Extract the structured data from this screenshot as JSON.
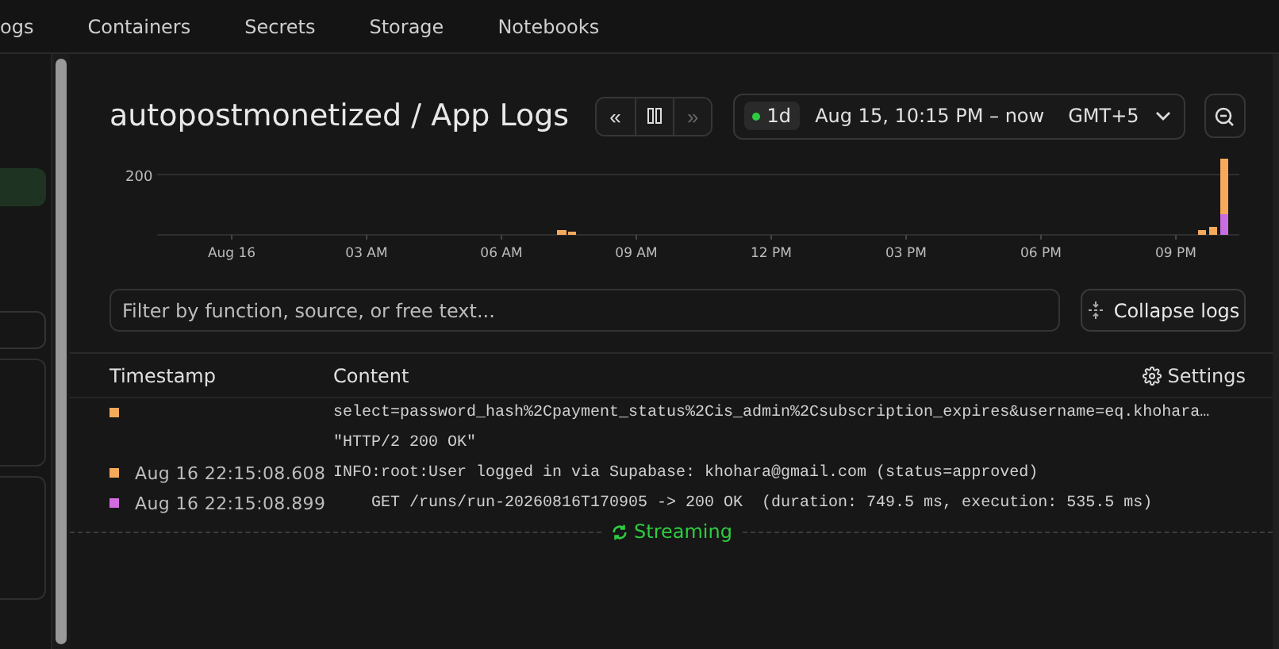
{
  "nav": {
    "tabs": [
      {
        "label": "ogs",
        "selected": false
      },
      {
        "label": "Containers",
        "selected": false
      },
      {
        "label": "Secrets",
        "selected": false
      },
      {
        "label": "Storage",
        "selected": false
      },
      {
        "label": "Notebooks",
        "selected": false
      }
    ]
  },
  "header": {
    "title": "autopostmonetized / App Logs",
    "controls": [
      {
        "kind": "rewind",
        "label": "«",
        "disabled": false
      },
      {
        "kind": "pause",
        "disabled": false
      },
      {
        "kind": "forward",
        "label": "»",
        "disabled": true
      }
    ],
    "range": {
      "live": true,
      "badge": "1d",
      "text": "Aug 15, 10:15 PM – now",
      "timezone": "GMT+5"
    }
  },
  "chart": {
    "y_label": "200",
    "x_labels": [
      "Aug 16",
      "03 AM",
      "06 AM",
      "09 AM",
      "12 PM",
      "03 PM",
      "06 PM",
      "09 PM"
    ]
  },
  "filter": {
    "placeholder": "Filter by function, source, or free text..."
  },
  "collapse_button": "Collapse logs",
  "table": {
    "columns": [
      "Timestamp",
      "Content"
    ],
    "settings": "Settings",
    "rows": [
      {
        "color": "#f5a95a",
        "indent": false,
        "lines": [
          "select=password_hash%2Cpayment_status%2Cis_admin%2Csubscription_expires&username=eq.khohara…",
          "\"HTTP/2 200 OK\""
        ]
      },
      {
        "color": "#f5a95a",
        "timestamp": "Aug 16 22:15:08.608",
        "indent": false,
        "lines": [
          "INFO:root:User logged in via Supabase: khohara@gmail.com (status=approved)"
        ]
      },
      {
        "color": "#d36be0",
        "timestamp": "Aug 16 22:15:08.899",
        "indent": true,
        "lines": [
          "GET /runs/run-20260816T170905 -> 200 OK  (duration: 749.5 ms, execution: 535.5 ms)"
        ]
      }
    ],
    "streaming": "Streaming"
  }
}
